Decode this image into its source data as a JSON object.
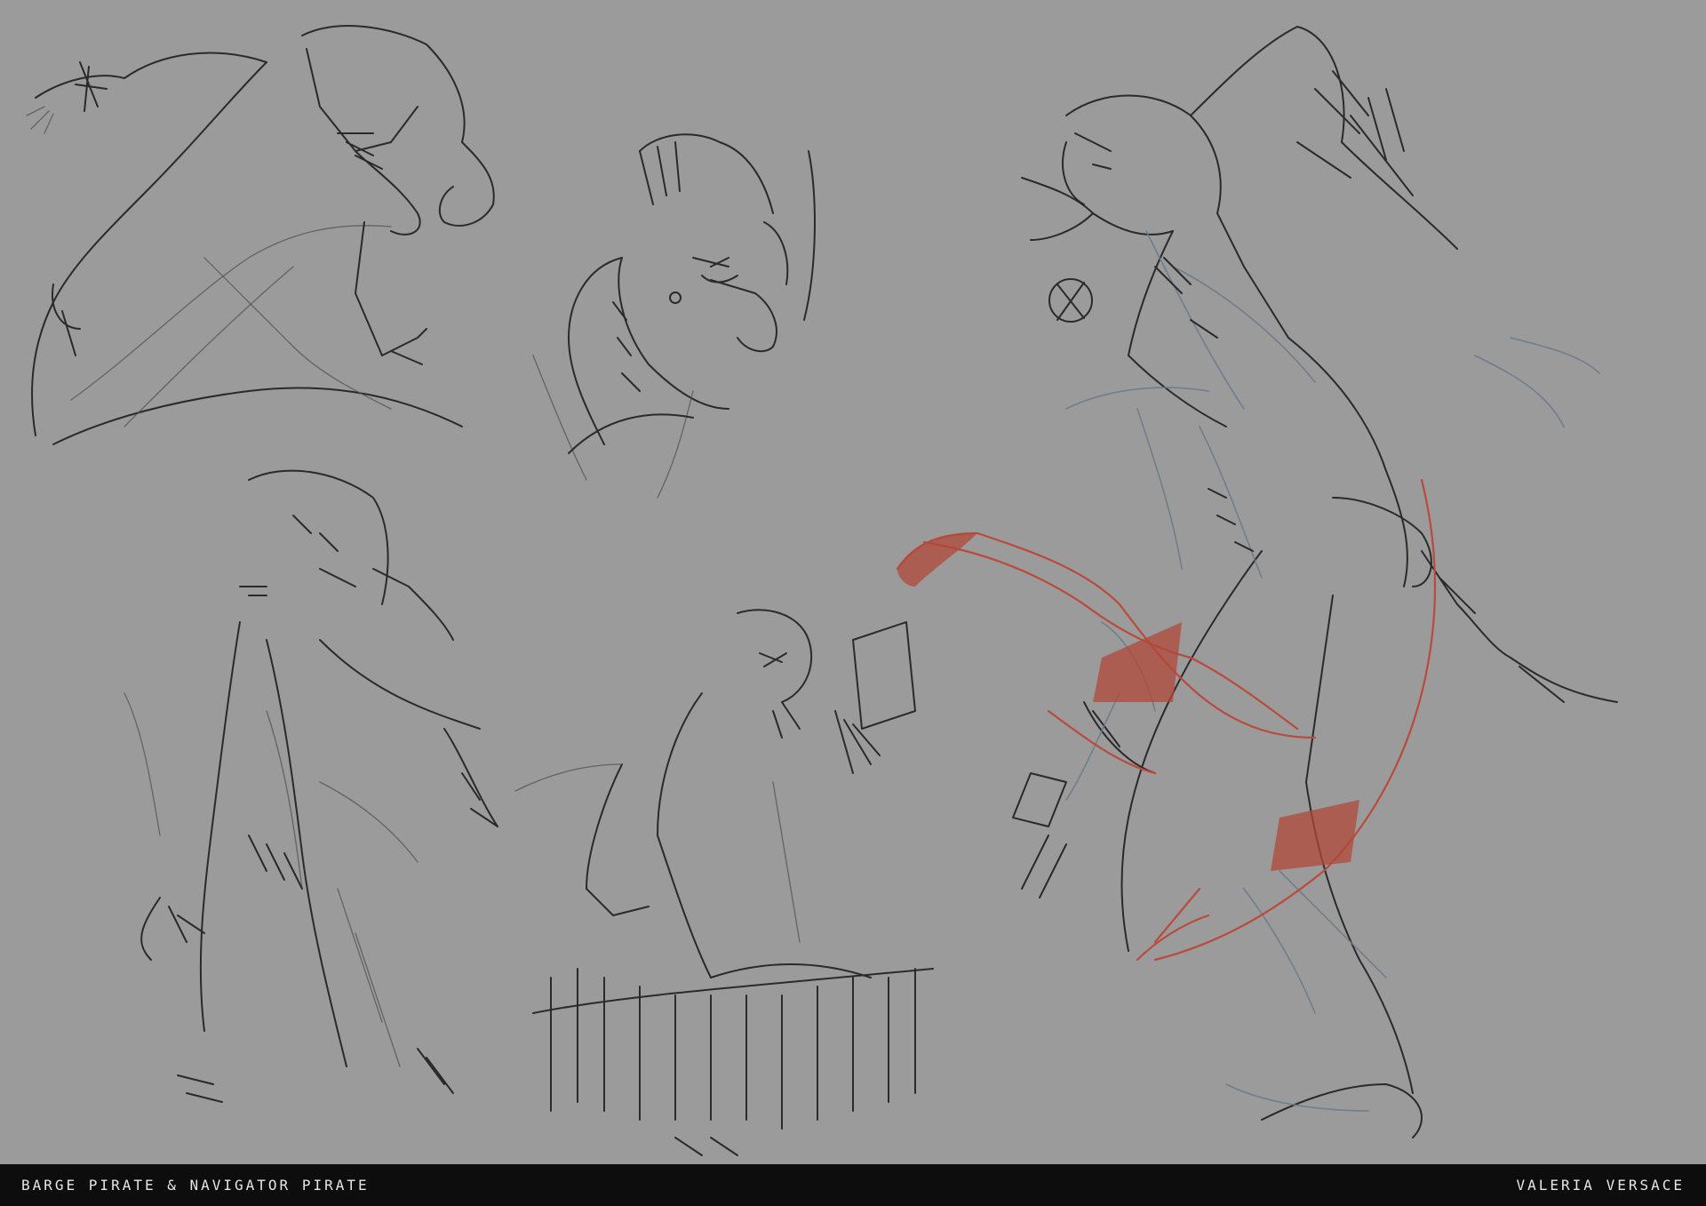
{
  "artwork": {
    "description_icon": "pencil-sketch-artwork",
    "background_color": "#9b9b9b",
    "sketch_color": "#2a2a2a",
    "accent_red": "#b94a3c",
    "construction_blue": "#6c7a8c"
  },
  "footer": {
    "title": "BARGE PIRATE & NAVIGATOR PIRATE",
    "artist": "VALERIA VERSACE",
    "background_color": "#0d0d0d"
  }
}
